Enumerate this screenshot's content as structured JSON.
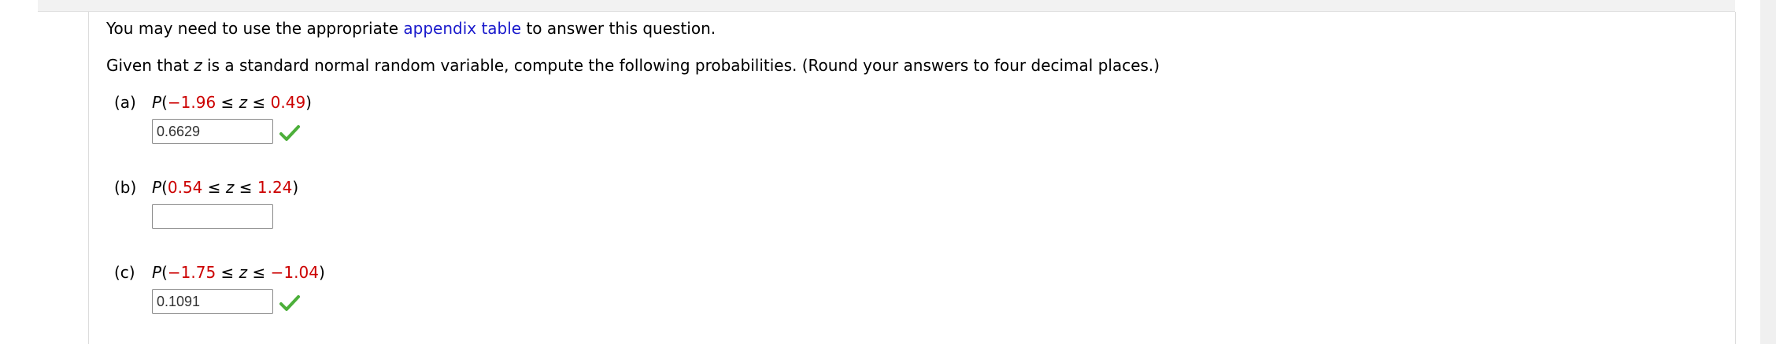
{
  "intro": {
    "before_link": "You may need to use the appropriate ",
    "link_text": "appendix table",
    "after_link": " to answer this question."
  },
  "prompt": {
    "part1": "Given that ",
    "variable": "z",
    "part2": " is a standard normal random variable, compute the following probabilities. (Round your answers to four decimal places.)"
  },
  "parts": [
    {
      "label": "(a)",
      "P": "P",
      "open": "(",
      "low": "−1.96",
      "le1": " ≤ ",
      "var": "z",
      "le2": " ≤ ",
      "high": "0.49",
      "close": ")",
      "answer": "0.6629",
      "status": "correct"
    },
    {
      "label": "(b)",
      "P": "P",
      "open": "(",
      "low": "0.54",
      "le1": " ≤ ",
      "var": "z",
      "le2": " ≤ ",
      "high": "1.24",
      "close": ")",
      "answer": "",
      "status": "unanswered"
    },
    {
      "label": "(c)",
      "P": "P",
      "open": "(",
      "low": "−1.75",
      "le1": " ≤ ",
      "var": "z",
      "le2": " ≤ ",
      "high": "−1.04",
      "close": ")",
      "answer": "0.1091",
      "status": "correct"
    }
  ],
  "colors": {
    "link": "#1a1acc",
    "number": "#cc0000",
    "check": "#4caf3a"
  },
  "icons": {
    "correct": "check-icon"
  }
}
